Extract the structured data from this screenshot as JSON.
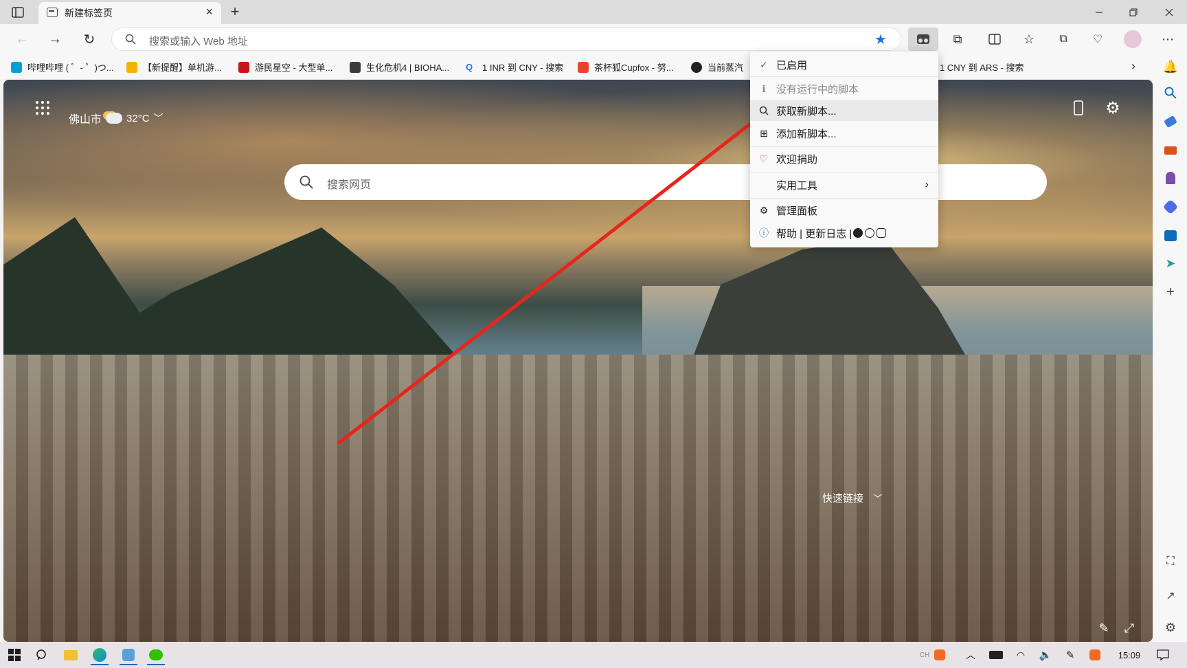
{
  "browser": {
    "tab_title": "新建标签页",
    "address_placeholder": "搜索或输入 Web 地址"
  },
  "bookmarks": [
    {
      "label": "哔哩哔哩 ( ゜- ゜)つ...",
      "color": "#00a1d6"
    },
    {
      "label": "【新提醒】单机游...",
      "color": "#f5b400"
    },
    {
      "label": "游民星空 - 大型单...",
      "color": "#c4161c"
    },
    {
      "label": "生化危机4 | BIOHA...",
      "color": "#3a3a3a"
    },
    {
      "label": "1 INR 到 CNY - 搜索",
      "color": "#1a73e8"
    },
    {
      "label": "茶杯狐Cupfox - 努...",
      "color": "#e8452c"
    },
    {
      "label": "当前蒸汽",
      "color": "#222222"
    },
    {
      "label": "1 CNY 到 ARS - 搜索",
      "color": ""
    }
  ],
  "newtab": {
    "city": "佛山市",
    "temperature": "32°C",
    "search_placeholder": "搜索网页",
    "quick_links": "快速链接"
  },
  "menu": {
    "items": [
      {
        "label": "已启用",
        "icon": "check-icon"
      },
      {
        "label": "没有运行中的脚本",
        "icon": "info-small-icon"
      },
      {
        "label": "获取新脚本...",
        "icon": "search-icon"
      },
      {
        "label": "添加新脚本...",
        "icon": "plus-square-icon"
      },
      {
        "label": "欢迎捐助",
        "icon": "heart-icon"
      },
      {
        "label": "实用工具",
        "icon": ""
      },
      {
        "label": "管理面板",
        "icon": "gear-icon"
      },
      {
        "label": "帮助 | 更新日志 |",
        "icon": "info-icon"
      }
    ]
  },
  "taskbar": {
    "time": "15:09",
    "ime": "CH"
  },
  "colors": {
    "accent": "#0067c0",
    "arrow": "#e8251a",
    "star": "#1a73e8"
  }
}
